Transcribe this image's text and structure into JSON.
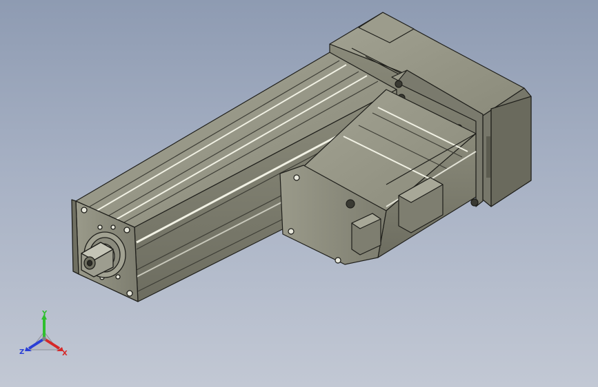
{
  "viewport": {
    "background_top": "#8e9bb2",
    "background_bottom": "#c2c8d4"
  },
  "model": {
    "body_color": "#8e8e7e",
    "shade_color": "#5f5f52",
    "highlight_color": "#d8d8cc",
    "edge_color": "#1e1e1a"
  },
  "triad": {
    "y_label": "Y",
    "x_label": "X",
    "z_label": "Z",
    "y_color": "#2fbf2f",
    "x_color": "#d62828",
    "z_color": "#2a3fd6"
  }
}
